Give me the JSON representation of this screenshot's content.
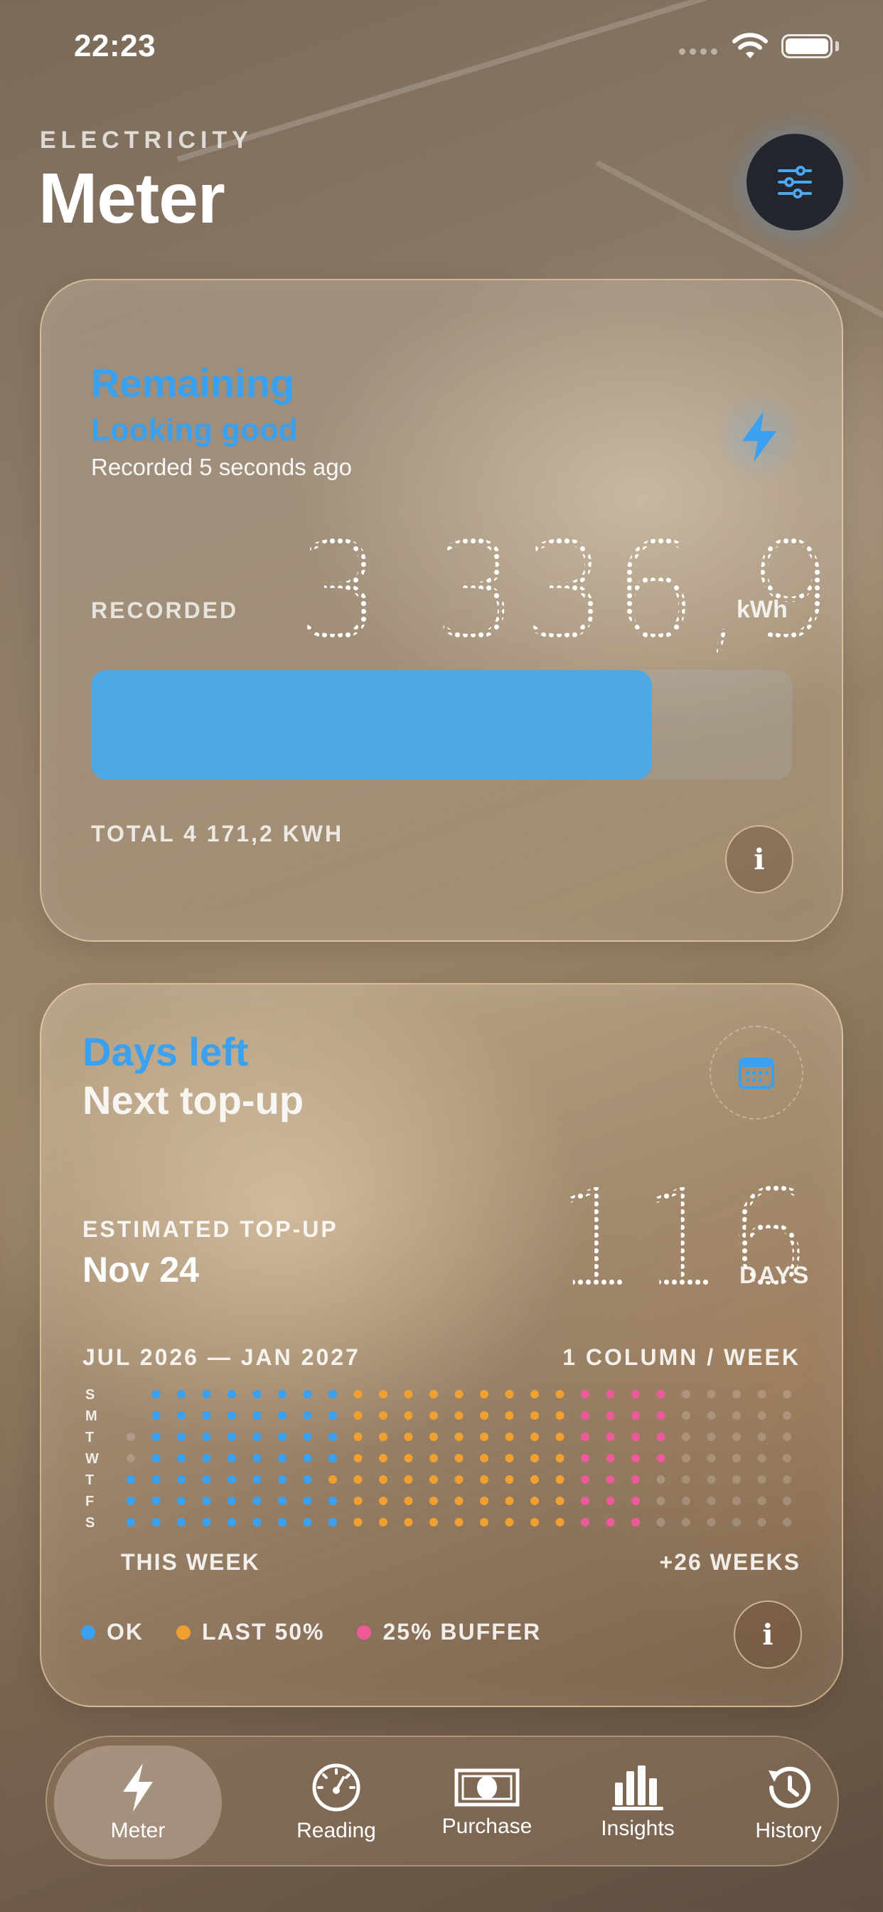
{
  "status_bar": {
    "time": "22:23"
  },
  "header": {
    "eyebrow": "ELECTRICITY",
    "title": "Meter"
  },
  "meter_card": {
    "title": "Remaining",
    "subtitle": "Looking good",
    "recorded_ago": "Recorded 5 seconds ago",
    "recorded_label": "RECORDED",
    "reading": "3 336,9",
    "unit": "kWh",
    "remaining_fraction": 0.8,
    "total": "TOTAL 4 171,2 KWH",
    "info_label": "i"
  },
  "days_card": {
    "title": "Days left",
    "subtitle": "Next top-up",
    "estimated_label": "ESTIMATED TOP-UP",
    "estimated_date": "Nov 24",
    "days": "116",
    "days_unit": "DAYS",
    "range": "JUL 2026 — JAN 2027",
    "per_week": "1 COLUMN / WEEK",
    "day_labels": [
      "S",
      "M",
      "T",
      "W",
      "T",
      "F",
      "S"
    ],
    "this_week": "THIS WEEK",
    "plus_weeks": "+26 WEEKS",
    "legend": [
      {
        "label": "OK",
        "color": "#3aa0f0"
      },
      {
        "label": "LAST 50%",
        "color": "#f0a030"
      },
      {
        "label": "25% BUFFER",
        "color": "#ec5a9a"
      }
    ],
    "weeks": 27,
    "info_label": "i"
  },
  "colors": {
    "accent": "#3aa0f0",
    "ok": "#3aa0f0",
    "last50": "#f0a030",
    "buffer": "#ec5a9a"
  },
  "tabs": [
    {
      "label": "Meter",
      "icon": "bolt-icon",
      "active": true
    },
    {
      "label": "Reading",
      "icon": "gauge-icon",
      "active": false
    },
    {
      "label": "Purchase",
      "icon": "banknote-icon",
      "active": false
    },
    {
      "label": "Insights",
      "icon": "bar-chart-icon",
      "active": false
    },
    {
      "label": "History",
      "icon": "clock-history-icon",
      "active": false
    }
  ]
}
